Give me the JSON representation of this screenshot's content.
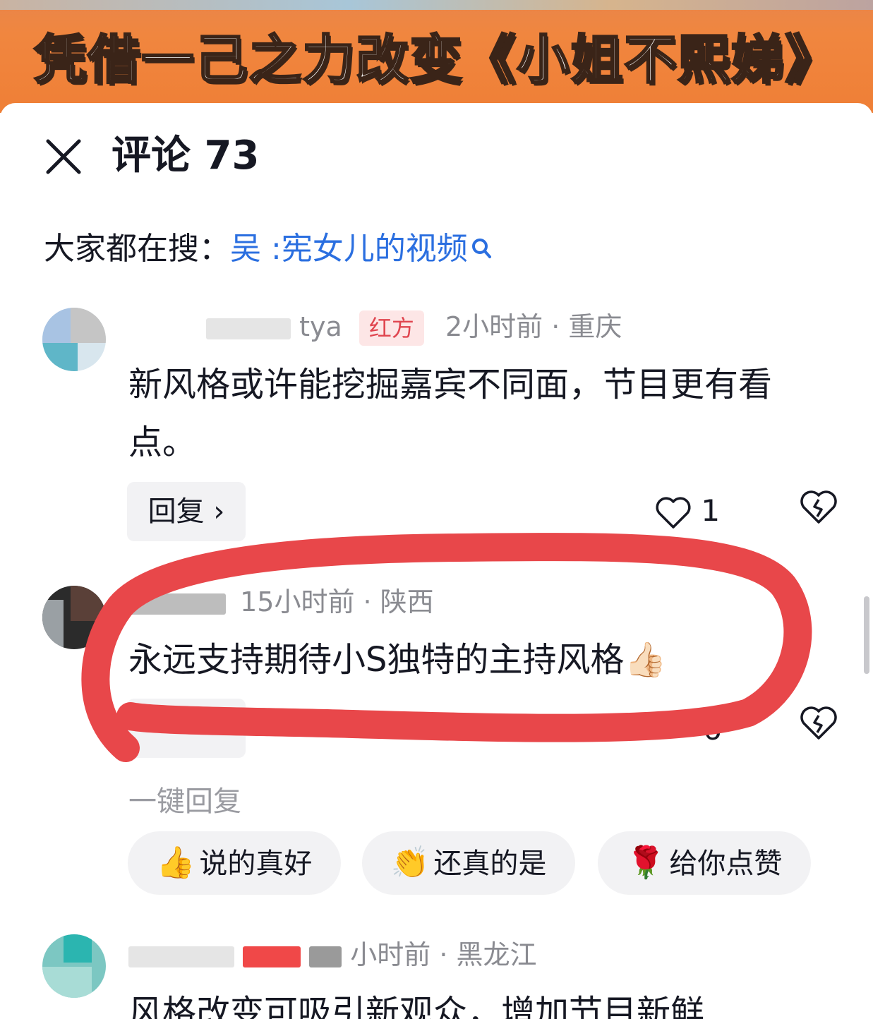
{
  "banner": {
    "title": "凭借一己之力改变《小姐不熙娣》"
  },
  "header": {
    "title": "评论 73"
  },
  "search": {
    "prefix": "大家都在搜：",
    "term": "吴 :宪女儿的视频"
  },
  "comments": [
    {
      "username_tail": "tya",
      "tag": "红方",
      "meta": "2小时前 · 重庆",
      "text": "新风格或许能挖掘嘉宾不同面，节目更有看点。",
      "reply_label": "回复",
      "likes": "1"
    },
    {
      "meta": "15小时前 · 陕西",
      "text": "永远支持期待小S独特的主持风格👍🏻",
      "likes": "6"
    },
    {
      "meta": "小时前 · 黑龙江",
      "text": "风格改变可吸引新观众，增加节目新鲜"
    }
  ],
  "quick_reply": {
    "label": "一键回复",
    "chips": [
      {
        "emoji": "👍",
        "text": "说的真好"
      },
      {
        "emoji": "👏",
        "text": "还真的是"
      },
      {
        "emoji": "🌹",
        "text": "给你点赞"
      }
    ]
  },
  "colors": {
    "accent_link": "#2b6fe0",
    "banner": "#f0863f",
    "tag_red": "#e0454f",
    "annotation_red": "#e8474a"
  }
}
